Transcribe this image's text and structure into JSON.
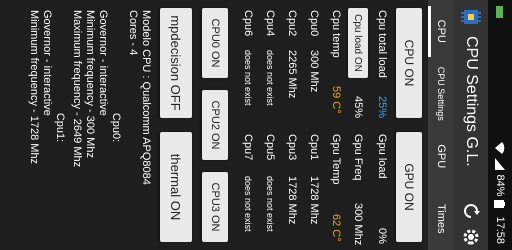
{
  "status": {
    "time": "17:58",
    "battery": "84%"
  },
  "app": {
    "title": "CPU Settings G.L."
  },
  "tabs": [
    {
      "label": "CPU"
    },
    {
      "label": "CPU Settings"
    },
    {
      "label": "GPU"
    },
    {
      "label": "Times"
    }
  ],
  "buttons": {
    "cpu_on": "CPU ON",
    "gpu_on": "GPU ON",
    "cpu0_on": "CPU0 ON",
    "cpu2_on": "CPU2 ON",
    "cpu3_on": "CPU3 ON",
    "mpdecision_off": "mpdecision OFF",
    "thermal_on": "thermal ON"
  },
  "cpu_stats": {
    "total_load_label": "Cpu total load",
    "total_load_value": "25%",
    "load_on_label": "Cpu load ON",
    "load_on_value": "45%",
    "temp_label": "Cpu temp",
    "temp_value": "59 C°"
  },
  "gpu_stats": {
    "load_label": "Gpu load",
    "load_value": "0%",
    "freq_label": "Gpu Freq",
    "freq_value": "300 Mhz",
    "temp_label": "Gpu Temp",
    "temp_value": "62 C°"
  },
  "cores_left": [
    {
      "name": "Cpu0",
      "value": "300 Mhz"
    },
    {
      "name": "Cpu2",
      "value": "2265 Mhz"
    },
    {
      "name": "Cpu4",
      "value": "does not exist"
    },
    {
      "name": "Cpu6",
      "value": "does not exist"
    }
  ],
  "cores_right": [
    {
      "name": "Cpu1",
      "value": "1728 Mhz"
    },
    {
      "name": "Cpu3",
      "value": "1728 Mhz"
    },
    {
      "name": "Cpu5",
      "value": "does not exist"
    },
    {
      "name": "Cpu7",
      "value": "does not exist"
    }
  ],
  "info": {
    "model": "Modelo CPU : Qualcomm APQ8084",
    "cores": "Cores - 4",
    "cpu0_header": "Cpu0:",
    "cpu0_governor": "Governor - interactive",
    "cpu0_min": "Minimum frequency - 300 Mhz",
    "cpu0_max": "Maximum frequency - 2649 Mhz",
    "cpu1_header": "Cpu1:",
    "cpu1_governor": "Governor - interactive",
    "cpu1_min": "Minimum frequency - 1728 Mhz"
  }
}
